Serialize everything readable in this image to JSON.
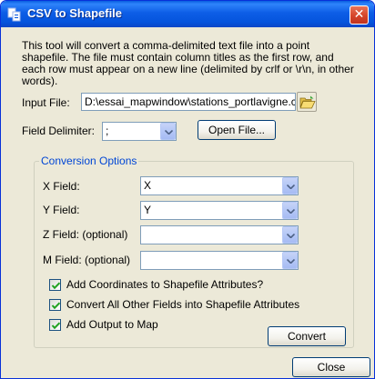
{
  "window": {
    "title": "CSV to Shapefile",
    "close_glyph": "✕"
  },
  "description": "This tool will convert a comma-delimited text file into a point shapefile. The file must contain column titles as the first row, and each row must appear on a new line (delimited by crlf or \\r\\n, in other words).",
  "input_file": {
    "label": "Input File:",
    "value": "D:\\essai_mapwindow\\stations_portlavigne.csv",
    "browse_icon": "folder-open-icon"
  },
  "field_delimiter": {
    "label": "Field Delimiter:",
    "value": ";"
  },
  "open_file_button": "Open File...",
  "conversion_options": {
    "title": "Conversion Options",
    "x_field": {
      "label": "X Field:",
      "value": "X"
    },
    "y_field": {
      "label": "Y Field:",
      "value": "Y"
    },
    "z_field": {
      "label": "Z Field: (optional)",
      "value": ""
    },
    "m_field": {
      "label": "M Field: (optional)",
      "value": ""
    },
    "checkboxes": [
      {
        "label": "Add Coordinates to Shapefile Attributes?",
        "checked": true
      },
      {
        "label": "Convert All Other Fields into Shapefile Attributes",
        "checked": true
      },
      {
        "label": "Add Output to Map",
        "checked": true
      }
    ],
    "convert_button": "Convert"
  },
  "close_button": "Close",
  "colors": {
    "titlebar": "#0554dd",
    "window_bg": "#ece9d8",
    "group_title": "#0046d5",
    "check_mark": "#21a121"
  }
}
